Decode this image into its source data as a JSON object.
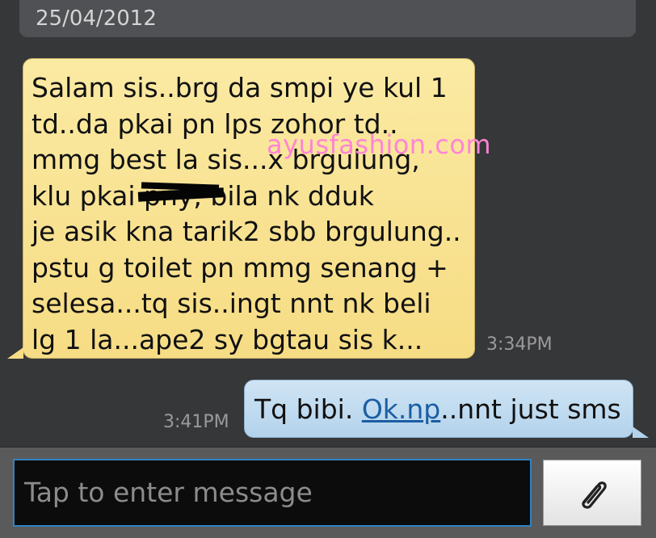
{
  "thread": {
    "date": "25/04/2012",
    "messages": [
      {
        "direction": "incoming",
        "text": "Salam sis..brg da smpi ye kul 1\ntd..da pkai pn lps zohor td..\nmmg best la sis...x brgulung,\nklu pkai         pny, bila nk dduk\nje asik kna tarik2 sbb brgulung..\npstu g toilet pn mmg senang +\nselesa...tq sis..ingt nnt nk beli\nlg 1 la...ape2 sy bgtau sis k...",
        "time": "3:34PM"
      },
      {
        "direction": "outgoing",
        "text_before": "Tq bibi. ",
        "link": "Ok.np",
        "text_after": "..nnt just sms",
        "time": "3:41PM"
      }
    ]
  },
  "watermark": "ayusfashion.com",
  "compose": {
    "placeholder": "Tap to enter message",
    "attach_icon": "paperclip-icon"
  },
  "colors": {
    "background": "#363739",
    "incoming_bubble": "#f6dc84",
    "outgoing_bubble": "#b3d3ec",
    "input_border": "#2f83c2",
    "watermark": "#ff84d6"
  }
}
